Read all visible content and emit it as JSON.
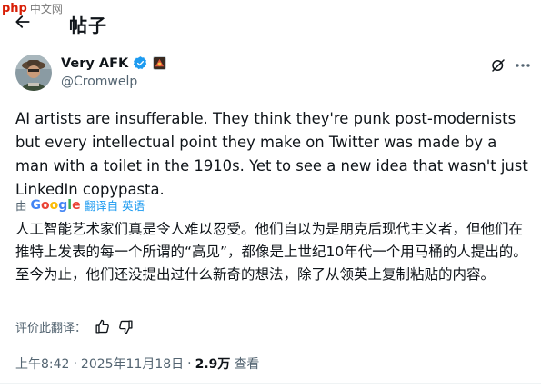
{
  "watermark": {
    "logo": "php",
    "text": "中文网"
  },
  "header": {
    "title": "帖子",
    "back_icon": "arrow-left-icon"
  },
  "author": {
    "name": "Very AFK",
    "handle": "@Cromwelp",
    "verified_icon": "verified-badge-icon",
    "badge_icon": "affiliate-badge-icon",
    "grok_icon": "grok-icon",
    "more_icon": "more-horizontal-icon"
  },
  "tweet": {
    "text": "AI artists are insufferable. They think they're punk post-modernists but every intellectual point they make on Twitter was made by a man with a toilet in the 1910s. Yet to see a new idea that wasn't just LinkedIn copypasta."
  },
  "translation": {
    "by_label": "由",
    "provider": "Google",
    "provider_letters": [
      "G",
      "o",
      "o",
      "g",
      "l",
      "e"
    ],
    "action_text": "翻译自 英语",
    "text": "人工智能艺术家们真是令人难以忍受。他们自以为是朋克后现代主义者，但他们在推特上发表的每一个所谓的“高见”，都像是上世纪10年代一个用马桶的人提出的。至今为止，他们还没提出过什么新奇的想法，除了从领英上复制粘贴的内容。",
    "rate_label": "评价此翻译：",
    "thumbs_up_icon": "thumbs-up-icon",
    "thumbs_down_icon": "thumbs-down-icon"
  },
  "meta": {
    "time": "上午8:42",
    "separator": "·",
    "date": "2025年11月18日",
    "views_count": "2.9万",
    "views_label": "查看"
  },
  "colors": {
    "text": "#0f1419",
    "secondary": "#536471",
    "link": "#1d9bf0",
    "verified": "#1d9bf0"
  }
}
